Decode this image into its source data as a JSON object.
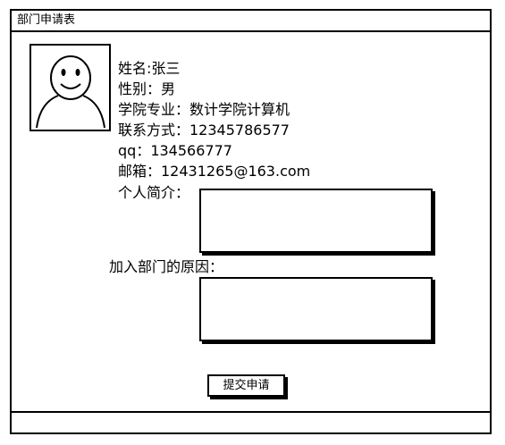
{
  "window": {
    "title": "部门申请表"
  },
  "profile": {
    "name": "姓名:张三",
    "gender": "性别：男",
    "college_major": "学院专业：数计学院计算机",
    "contact": "联系方式：12345786577",
    "qq": "qq：134566777",
    "email": "邮箱：12431265@163.com",
    "intro_label": "个人简介："
  },
  "reason_label": "加入部门的原因：",
  "submit_label": "提交申请",
  "icons": {
    "avatar": "smiley-person-icon"
  }
}
